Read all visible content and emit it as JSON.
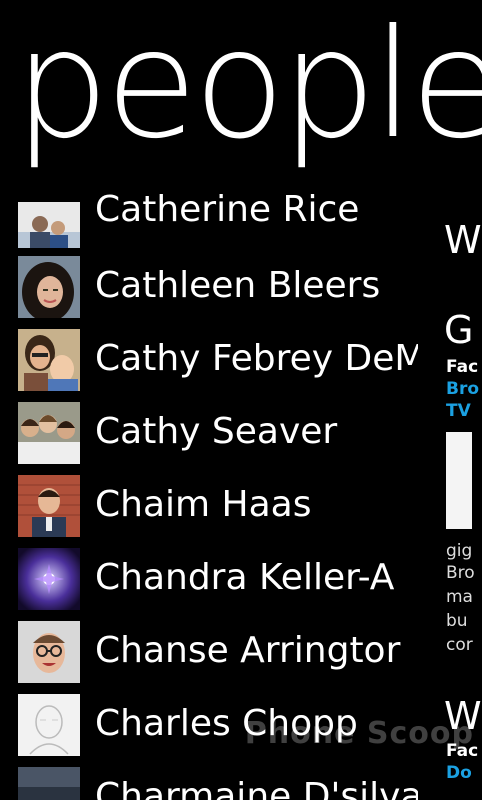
{
  "header": {
    "title": "people"
  },
  "contacts": [
    {
      "name": "Catherine Rice",
      "avatar_icon": "photo-two-people-icon"
    },
    {
      "name": "Cathleen Bleers",
      "avatar_icon": "photo-woman-dark-hair-icon"
    },
    {
      "name": "Cathy Febrey DeM",
      "avatar_icon": "photo-woman-child-icon"
    },
    {
      "name": "Cathy Seaver",
      "avatar_icon": "photo-group-women-icon"
    },
    {
      "name": "Chaim Haas",
      "avatar_icon": "photo-man-brick-wall-icon"
    },
    {
      "name": "Chandra Keller-A",
      "avatar_icon": "photo-purple-flower-icon"
    },
    {
      "name": "Chanse Arringtor",
      "avatar_icon": "photo-man-glasses-icon"
    },
    {
      "name": "Charles Chopp",
      "avatar_icon": "default-contact-sketch-icon"
    },
    {
      "name": "Charmaine D'silva",
      "avatar_icon": "photo-dark-icon"
    }
  ],
  "side_pane": {
    "big_letter_1": "W",
    "big_letter_2": "G",
    "small_1": "Fac",
    "small_2": "Bro",
    "small_3": "TV",
    "small_4": "gig",
    "small_5": "Bro",
    "small_6": "ma",
    "small_7": "bu",
    "small_8": "cor",
    "big_letter_3": "W",
    "small_9": "Fac",
    "small_10": "Do"
  },
  "watermark": "Phone Scoop",
  "colors": {
    "background": "#000000",
    "text": "#ffffff",
    "accent": "#1ba1e2"
  }
}
